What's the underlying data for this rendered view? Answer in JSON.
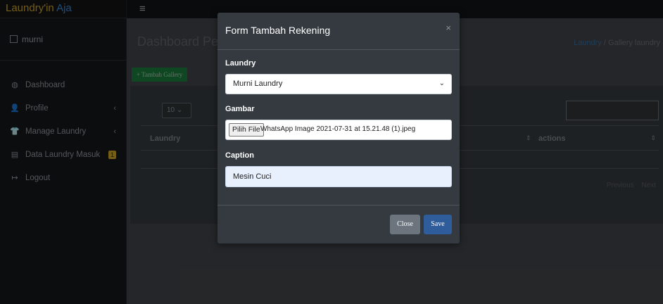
{
  "brand": {
    "name": "Laundry'in",
    "suffix": " Aja"
  },
  "user": {
    "name": "murni"
  },
  "sidebar": {
    "items": [
      {
        "icon": "dashboard-icon",
        "glyph": "◍",
        "label": "Dashboard"
      },
      {
        "icon": "user-icon",
        "glyph": "👤",
        "label": "Profile",
        "chevron": "‹"
      },
      {
        "icon": "shirt-icon",
        "glyph": "👕",
        "label": "Manage Laundry",
        "chevron": "‹"
      },
      {
        "icon": "list-icon",
        "glyph": "▤",
        "label": "Data Laundry Masuk",
        "badge": "1"
      },
      {
        "icon": "logout-icon",
        "glyph": "↦",
        "label": "Logout"
      }
    ]
  },
  "topbar": {
    "menu_glyph": "≡"
  },
  "page": {
    "title": "Dashboard Pe",
    "breadcrumb": {
      "link": "Laundry",
      "separator": " / ",
      "current": "Gallery laundry"
    },
    "add_button": "+ Tambah Gallery"
  },
  "table": {
    "length_value": "10",
    "columns": [
      "Laundry",
      "actions"
    ],
    "sort_glyph": "⇕",
    "pager": {
      "prev": "Previous",
      "next": "Next"
    }
  },
  "modal": {
    "title": "Form Tambah Rekening",
    "close_glyph": "×",
    "fields": {
      "laundry_label": "Laundry",
      "laundry_value": "Murni Laundry",
      "gambar_label": "Gambar",
      "file_button": "Pilih File",
      "file_name": "WhatsApp Image 2021-07-31 at 15.21.48 (1).jpeg",
      "caption_label": "Caption",
      "caption_value": "Mesin Cuci"
    },
    "buttons": {
      "close": "Close",
      "save": "Save"
    }
  }
}
